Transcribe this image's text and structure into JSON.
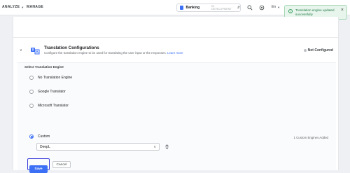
{
  "nav": {
    "analyze": "ANALYZE",
    "manage": "MANAGE"
  },
  "app": {
    "name": "Banking",
    "environment": "IN DEVELOPMENT",
    "icon": "app-icon"
  },
  "header": {
    "language": "En",
    "icons": [
      "search-icon",
      "settings-icon"
    ]
  },
  "toast": {
    "message": "Translation engine updated successfully",
    "status_color": "#2e9d5b"
  },
  "section": {
    "title": "Translation Configurations",
    "description": "Configure the translation engine to be used for translating the user input or the responses.",
    "learn_more": "Learn more",
    "status": "Not Configured"
  },
  "engines": {
    "label": "Select Translation Engine",
    "options": [
      {
        "label": "No Translation Engine",
        "selected": false
      },
      {
        "label": "Google Translator",
        "selected": false
      },
      {
        "label": "Microsoft Translator",
        "selected": false
      },
      {
        "label": "Custom",
        "selected": true
      }
    ],
    "custom_count": "1 Custom Engines Added",
    "custom_value": "DeepL"
  },
  "actions": {
    "save": "Save",
    "cancel": "Cancel"
  },
  "colors": {
    "accent": "#3b6ff5",
    "focus_ring": "#3b3fd8"
  }
}
